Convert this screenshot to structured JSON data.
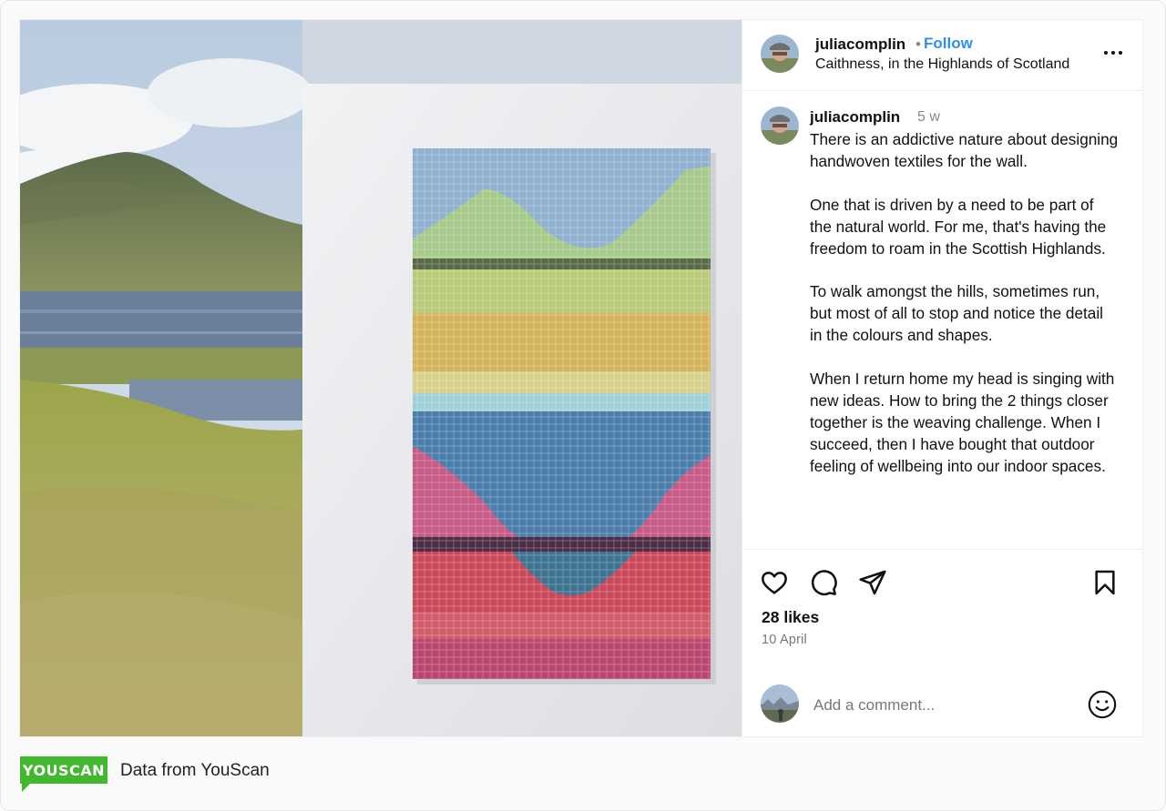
{
  "post": {
    "username": "juliacomplin",
    "separator": "•",
    "follow_label": "Follow",
    "location": "Caithness, in the Highlands of Scotland",
    "more_icon": "more-options-icon",
    "caption": {
      "username": "juliacomplin",
      "time_ago": "5 w",
      "paragraphs": [
        "There is an addictive nature about designing handwoven textiles for the wall.",
        "One that is driven by a need to be part of the natural world. For me, that's having the freedom to roam in the Scottish Highlands.",
        "To walk amongst the hills, sometimes run, but most of all to stop and notice the detail in the colours and shapes.",
        "When I return home my head is singing with new ideas. How to bring the 2 things closer together is the weaving challenge. When I succeed, then I have bought that outdoor feeling of wellbeing into our indoor spaces."
      ]
    },
    "actions": {
      "like_icon": "heart-icon",
      "comment_icon": "comment-icon",
      "share_icon": "share-icon",
      "save_icon": "bookmark-icon"
    },
    "likes": "28 likes",
    "date": "10 April",
    "comment_placeholder": "Add a comment...",
    "emoji_icon": "emoji-icon"
  },
  "footer": {
    "brand": "YOUSCAN",
    "source_text": "Data from YouScan"
  },
  "colors": {
    "follow": "#2f8ff0",
    "brand_green": "#41b82e",
    "muted": "#777777"
  }
}
